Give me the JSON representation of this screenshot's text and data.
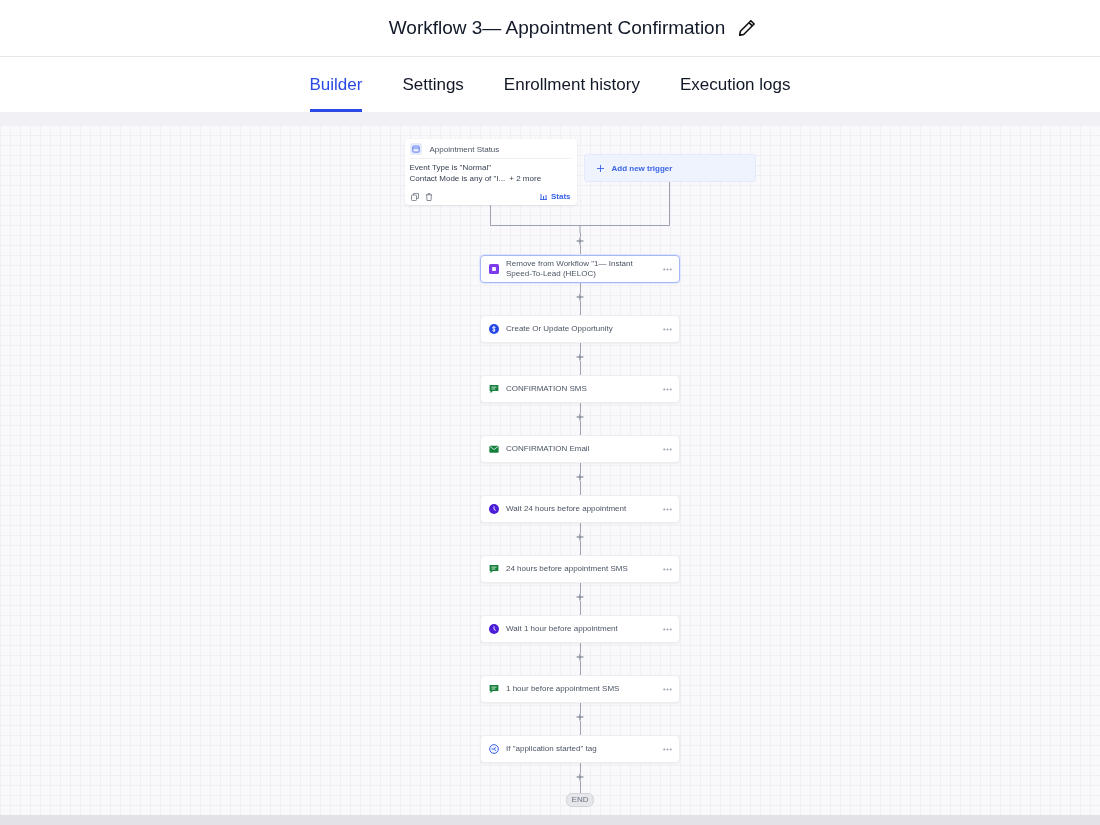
{
  "header": {
    "title": "Workflow 3— Appointment Confirmation"
  },
  "tabs": [
    {
      "label": "Builder",
      "selected": true
    },
    {
      "label": "Settings",
      "selected": false
    },
    {
      "label": "Enrollment history",
      "selected": false
    },
    {
      "label": "Execution logs",
      "selected": false
    }
  ],
  "trigger": {
    "title": "Appointment Status",
    "conditions": [
      {
        "text": "Event Type is \"Normal\""
      },
      {
        "text": "Contact Mode is any of \"I...",
        "more": "+ 2 more"
      }
    ],
    "stats_label": "Stats"
  },
  "add_trigger": {
    "label": "Add new trigger"
  },
  "steps": [
    {
      "kind": "remove_workflow",
      "label": "Remove from Workflow \"1— Instant Speed-To-Lead (HELOC)",
      "selected": true
    },
    {
      "kind": "opportunity",
      "label": "Create Or Update Opportunity",
      "selected": false
    },
    {
      "kind": "sms",
      "label": "CONFIRMATION SMS",
      "selected": false
    },
    {
      "kind": "email",
      "label": "CONFIRMATION Email",
      "selected": false
    },
    {
      "kind": "wait",
      "label": "Wait 24 hours before appointment",
      "selected": false
    },
    {
      "kind": "sms",
      "label": "24 hours before appointment SMS",
      "selected": false
    },
    {
      "kind": "wait",
      "label": "Wait 1 hour before appointment",
      "selected": false
    },
    {
      "kind": "sms",
      "label": "1 hour before appointment SMS",
      "selected": false
    },
    {
      "kind": "condition",
      "label": "If \"application started\" tag",
      "selected": false
    }
  ],
  "end": {
    "label": "END"
  }
}
